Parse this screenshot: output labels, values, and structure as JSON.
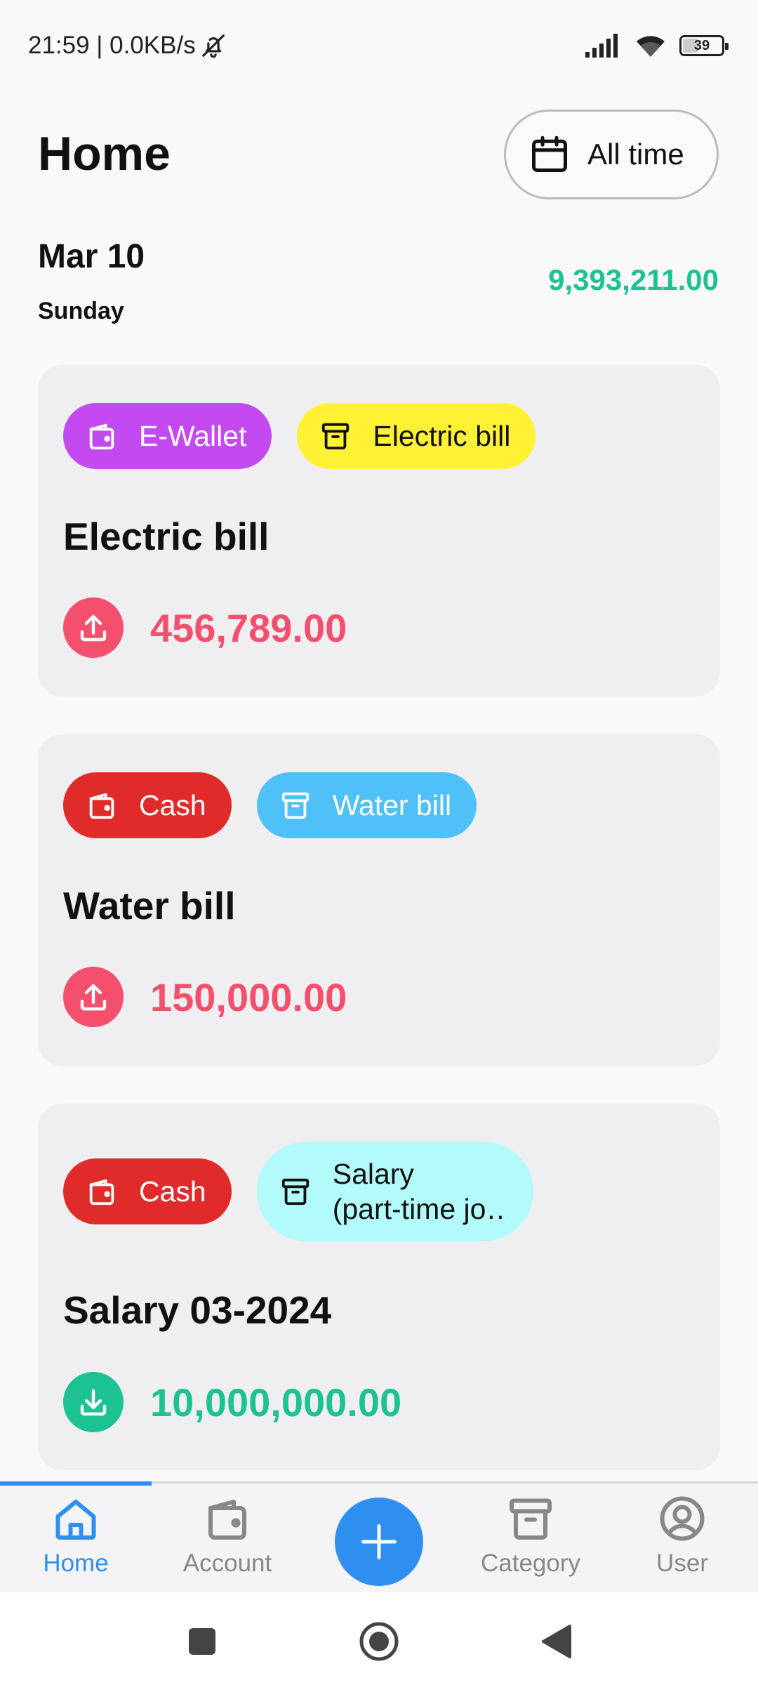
{
  "status_bar": {
    "time_speed": "21:59 | 0.0KB/s",
    "battery": "39",
    "icons": [
      "bell-off-icon",
      "signal-icon",
      "wifi-icon",
      "battery-icon"
    ]
  },
  "header": {
    "title": "Home",
    "range_label": "All time",
    "range_icon": "calendar-icon"
  },
  "day": {
    "date": "Mar 10",
    "weekday": "Sunday",
    "total": "9,393,211.00",
    "total_color": "#1dc292"
  },
  "transactions": [
    {
      "account": {
        "label": "E-Wallet",
        "icon": "wallet-icon",
        "bg": "#c34af0",
        "fg": "#ffffff"
      },
      "category": {
        "label": "Electric bill",
        "icon": "archive-icon",
        "bg": "#fff134",
        "fg": "#111111"
      },
      "title": "Electric bill",
      "amount": "456,789.00",
      "type": "expense",
      "color": "#f44f6d"
    },
    {
      "account": {
        "label": "Cash",
        "icon": "wallet-icon",
        "bg": "#e12b2b",
        "fg": "#ffffff"
      },
      "category": {
        "label": "Water bill",
        "icon": "archive-icon",
        "bg": "#50c0f8",
        "fg": "#ffffff"
      },
      "title": "Water bill",
      "amount": "150,000.00",
      "type": "expense",
      "color": "#f44f6d"
    },
    {
      "account": {
        "label": "Cash",
        "icon": "wallet-icon",
        "bg": "#e12b2b",
        "fg": "#ffffff"
      },
      "category": {
        "label": "Salary (part-time jo…",
        "line1": "Salary",
        "line2": "(part-time jo…",
        "icon": "archive-icon",
        "bg": "#b3fafa",
        "fg": "#111111"
      },
      "title": "Salary 03-2024",
      "amount": "10,000,000.00",
      "type": "income",
      "color": "#1dc292"
    }
  ],
  "bottom_nav": {
    "items": [
      {
        "label": "Home",
        "icon": "home-icon",
        "active": true
      },
      {
        "label": "Account",
        "icon": "wallet-icon",
        "active": false
      },
      {
        "label": "Category",
        "icon": "archive-icon",
        "active": false
      },
      {
        "label": "User",
        "icon": "user-icon",
        "active": false
      }
    ],
    "add_icon": "plus-icon",
    "accent": "#2e8ff0"
  },
  "system_nav": {
    "icons": [
      "recents-icon",
      "home-circle-icon",
      "back-icon"
    ]
  }
}
